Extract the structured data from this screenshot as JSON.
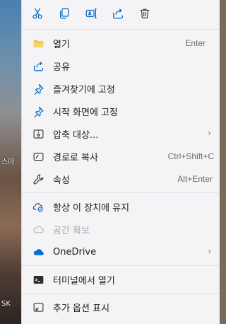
{
  "desktop": {
    "labels": [
      "스마",
      "SK"
    ]
  },
  "toolbar": {
    "cut": "cut-icon",
    "copy": "copy-icon",
    "rename": "rename-icon",
    "share": "share-icon",
    "delete": "delete-icon"
  },
  "menu": {
    "open": {
      "label": "열기",
      "shortcut": "Enter"
    },
    "share": {
      "label": "공유"
    },
    "pin_favorites": {
      "label": "즐겨찾기에 고정"
    },
    "pin_start": {
      "label": "시작 화면에 고정"
    },
    "compress": {
      "label": "압축 대상..."
    },
    "copy_path": {
      "label": "경로로 복사",
      "shortcut": "Ctrl+Shift+C"
    },
    "properties": {
      "label": "속성",
      "shortcut": "Alt+Enter"
    },
    "keep_on_device": {
      "label": "항상 이 장치에 유지"
    },
    "free_space": {
      "label": "공간 확보"
    },
    "onedrive": {
      "label": "OneDrive"
    },
    "terminal": {
      "label": "터미널에서 열기"
    },
    "more_options": {
      "label": "추가 옵션 표시"
    }
  },
  "colors": {
    "accent": "#0067c0",
    "folder": "#f2c14e",
    "onedrive": "#0a6ed1"
  }
}
